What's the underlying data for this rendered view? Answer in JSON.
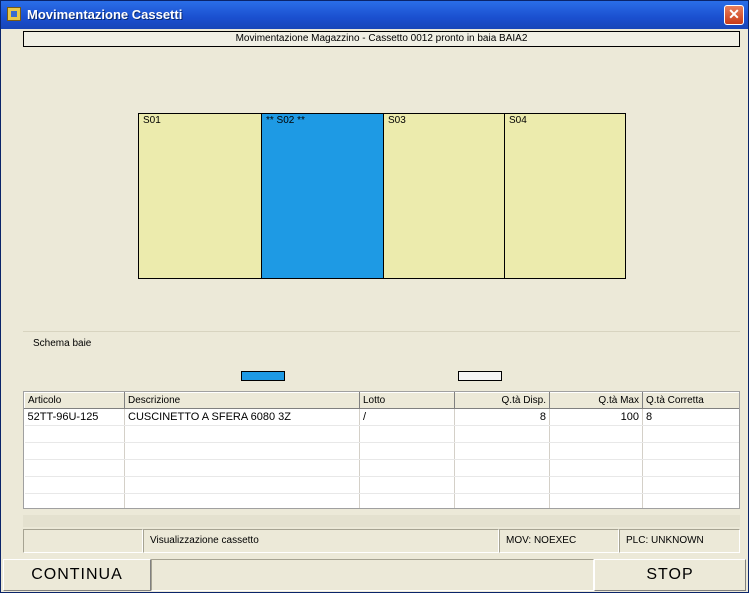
{
  "window": {
    "title": "Movimentazione Cassetti"
  },
  "header": {
    "label": "Movimentazione Magazzino - Cassetto 0012 pronto in baia BAIA2"
  },
  "bays": [
    {
      "label": "S01",
      "state": "free",
      "color": "#ecebad"
    },
    {
      "label": "** S02 **",
      "state": "active",
      "color": "#1e9ae4"
    },
    {
      "label": "S03",
      "state": "free",
      "color": "#ecebad"
    },
    {
      "label": "S04",
      "state": "free",
      "color": "#ecebad"
    }
  ],
  "legend": {
    "title": "Schema baie",
    "active_color": "#1e9ae4",
    "free_color": "#f4f4f4"
  },
  "table": {
    "columns": [
      "Articolo",
      "Descrizione",
      "Lotto",
      "Q.tà Disp.",
      "Q.tà Max",
      "Q.tà Corretta"
    ],
    "rows": [
      [
        "52TT-96U-125",
        "CUSCINETTO A SFERA 6080 3Z",
        "/",
        "8",
        "100",
        "8"
      ]
    ]
  },
  "status": {
    "message": "Visualizzazione cassetto",
    "mov": "MOV: NOEXEC",
    "plc": "PLC: UNKNOWN"
  },
  "buttons": {
    "continue": "CONTINUA",
    "stop": "STOP"
  }
}
